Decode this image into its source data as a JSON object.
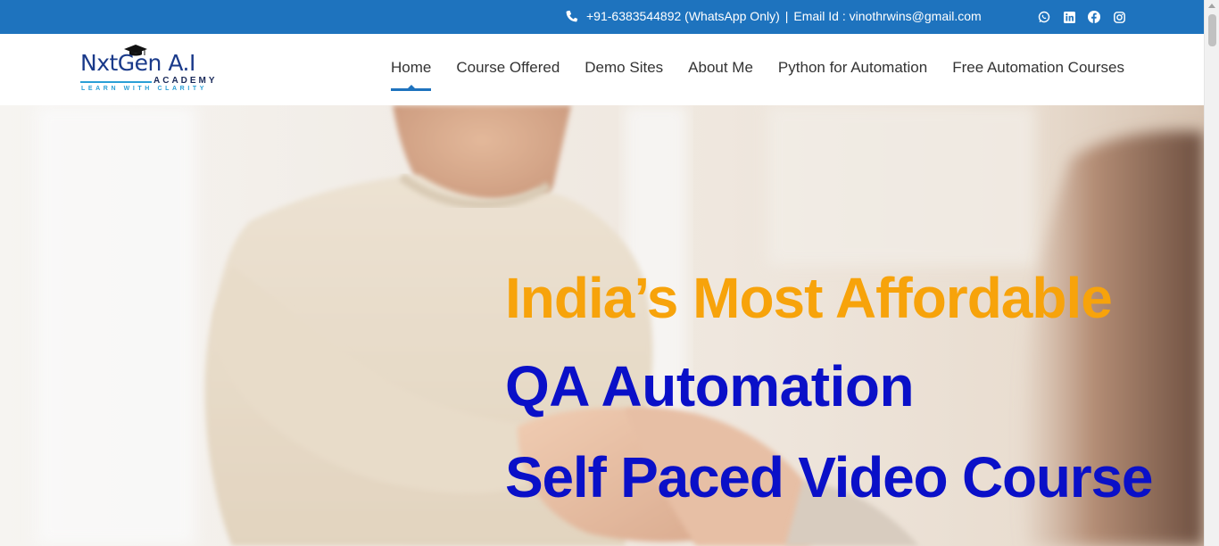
{
  "topbar": {
    "phone": "+91-6383544892 (WhatsApp Only)",
    "separator": "|",
    "email": "Email Id : vinothrwins@gmail.com",
    "social": [
      {
        "icon": "whatsapp-icon"
      },
      {
        "icon": "linkedin-icon"
      },
      {
        "icon": "facebook-icon"
      },
      {
        "icon": "instagram-icon"
      }
    ],
    "bg_color": "#1e73be"
  },
  "logo": {
    "main": "NxtGen A.I",
    "sub": "ACADEMY",
    "tagline": "LEARN WITH CLARITY"
  },
  "nav": {
    "items": [
      {
        "label": "Home",
        "active": true
      },
      {
        "label": "Course Offered",
        "active": false
      },
      {
        "label": "Demo Sites",
        "active": false
      },
      {
        "label": "About Me",
        "active": false
      },
      {
        "label": "Python for Automation",
        "active": false
      },
      {
        "label": "Free Automation Courses",
        "active": false
      }
    ]
  },
  "hero": {
    "line1": "India’s Most Affordable",
    "line2": "QA Automation",
    "line3": "Self Paced Video Course",
    "line1_color": "#f7a30b",
    "line23_color": "#0a10c8"
  }
}
